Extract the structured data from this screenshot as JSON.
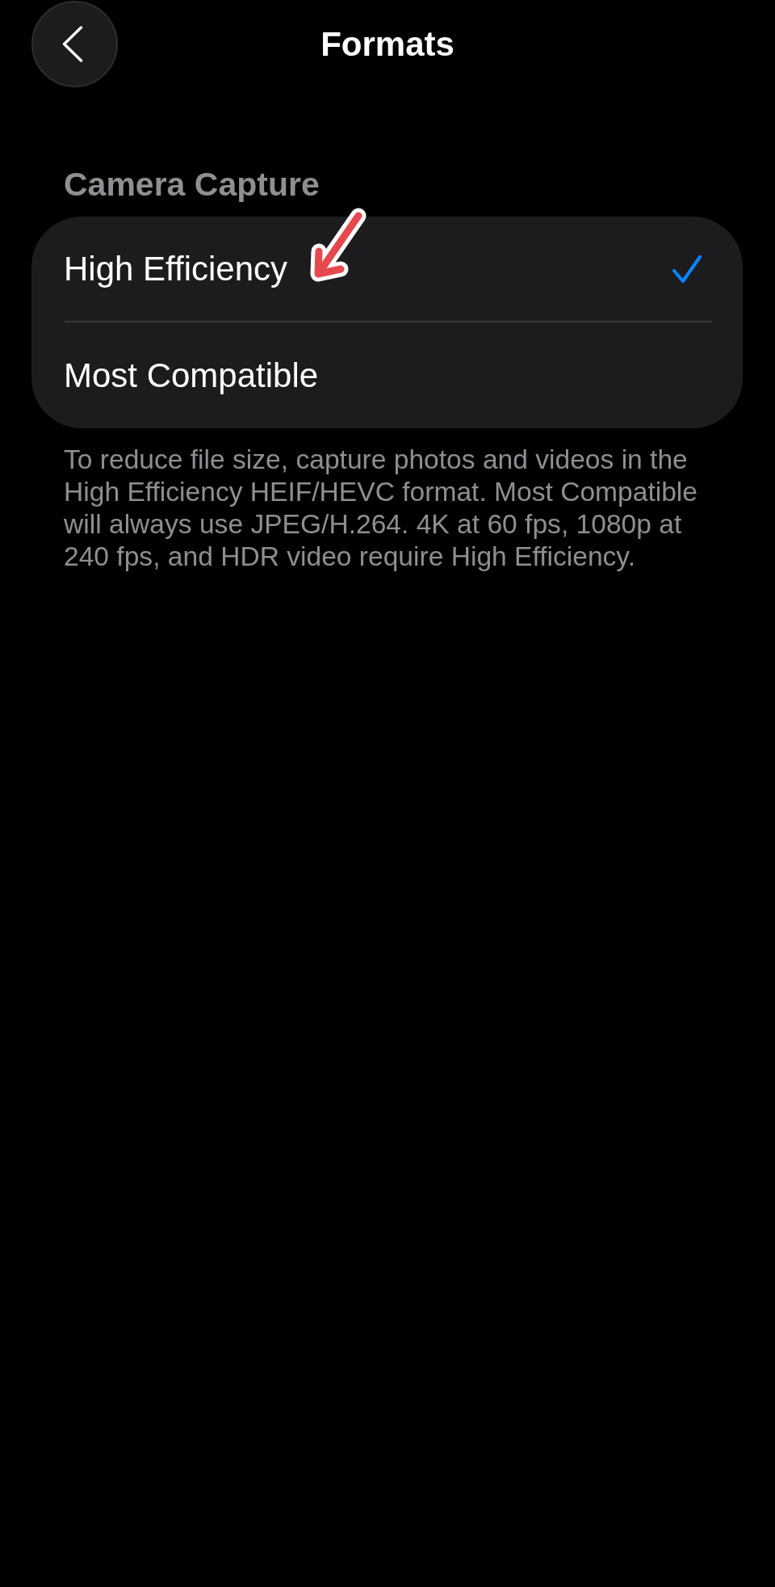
{
  "nav": {
    "title": "Formats"
  },
  "sections": [
    {
      "header": "Camera Capture",
      "options": [
        {
          "label": "High Efficiency",
          "selected": true
        },
        {
          "label": "Most Compatible",
          "selected": false
        }
      ],
      "footer": "To reduce file size, capture photos and videos in the High Efficiency HEIF/HEVC format. Most Compatible will always use JPEG/H.264. 4K at 60 fps, 1080p at 240 fps, and HDR video require High Efficiency."
    }
  ]
}
